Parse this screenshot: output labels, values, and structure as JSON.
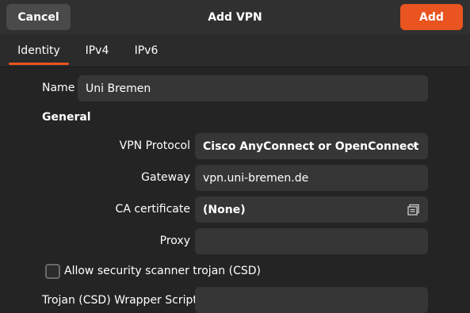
{
  "header": {
    "cancel_label": "Cancel",
    "title": "Add VPN",
    "add_label": "Add"
  },
  "tabs": [
    {
      "label": "Identity",
      "active": true
    },
    {
      "label": "IPv4",
      "active": false
    },
    {
      "label": "IPv6",
      "active": false
    }
  ],
  "form": {
    "name_label": "Name",
    "name_value": "Uni Bremen",
    "section_general": "General",
    "vpn_protocol_label": "VPN Protocol",
    "vpn_protocol_value": "Cisco AnyConnect or OpenConnect",
    "gateway_label": "Gateway",
    "gateway_value": "vpn.uni-bremen.de",
    "ca_cert_label": "CA certificate",
    "ca_cert_value": "(None)",
    "proxy_label": "Proxy",
    "proxy_value": "",
    "csd_checkbox_label": "Allow security scanner trojan (CSD)",
    "csd_checked": false,
    "csd_wrapper_label": "Trojan (CSD) Wrapper Script",
    "csd_wrapper_value": ""
  },
  "colors": {
    "accent": "#e95420",
    "background": "#242424",
    "field": "#363636"
  },
  "icons": {
    "protocol_dropdown": "chevron-down-icon",
    "ca_file_picker": "file-chooser-icon"
  }
}
